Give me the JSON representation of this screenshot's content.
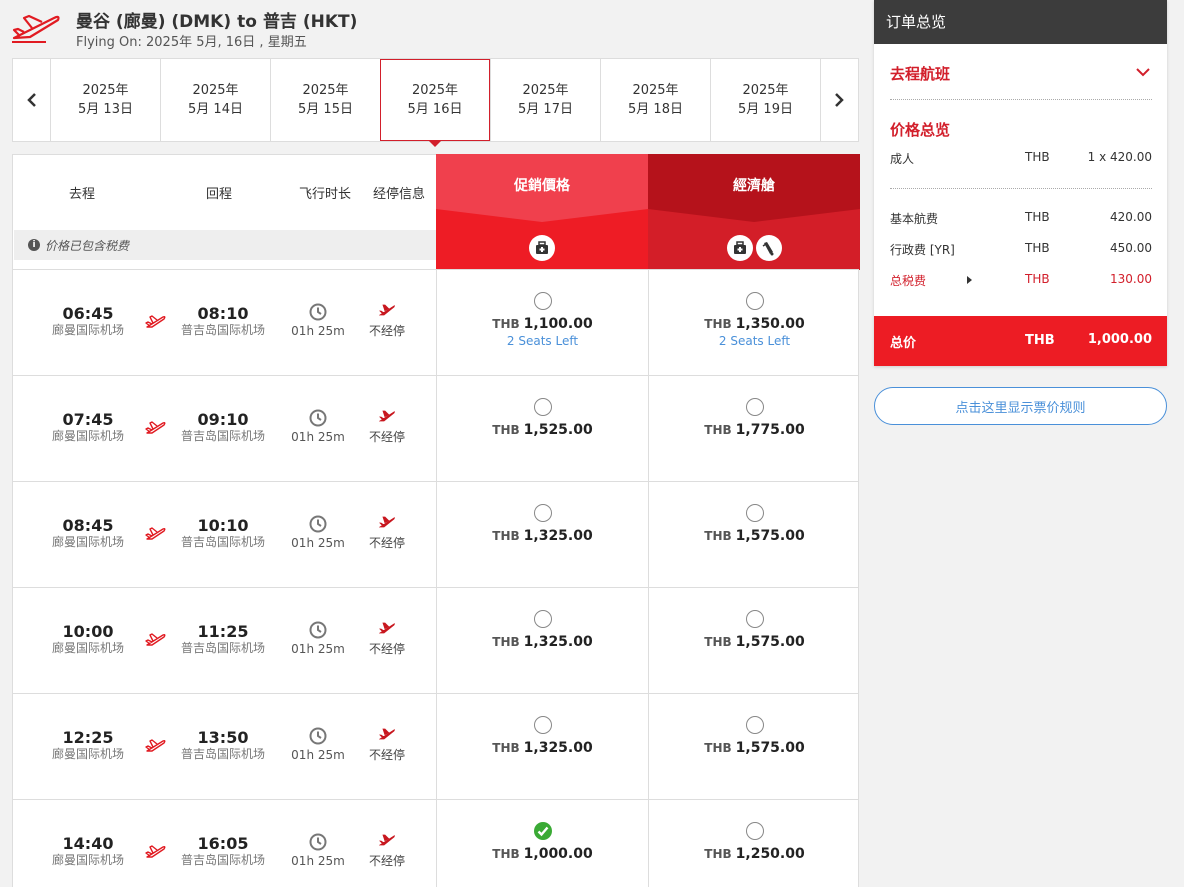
{
  "header": {
    "origin": "曼谷 (廊曼) (DMK)",
    "to_word": "to",
    "destination": "普吉 (HKT)",
    "flying_on": "Flying On: 2025年 5月, 16日 , 星期五"
  },
  "dates": [
    {
      "year": "2025年",
      "day": "5月 13日",
      "selected": false
    },
    {
      "year": "2025年",
      "day": "5月 14日",
      "selected": false
    },
    {
      "year": "2025年",
      "day": "5月 15日",
      "selected": false
    },
    {
      "year": "2025年",
      "day": "5月 16日",
      "selected": true
    },
    {
      "year": "2025年",
      "day": "5月 17日",
      "selected": false
    },
    {
      "year": "2025年",
      "day": "5月 18日",
      "selected": false
    },
    {
      "year": "2025年",
      "day": "5月 19日",
      "selected": false
    }
  ],
  "columns": {
    "depart": "去程",
    "arrive": "回程",
    "duration": "飞行时长",
    "stops": "经停信息",
    "tax_note": "价格已包含税费",
    "fare_promo": "促銷價格",
    "fare_economy": "經濟艙"
  },
  "colors": {
    "promo_top": "#f0404d",
    "promo_bottom": "#ee1c25",
    "economy_top": "#b5121b",
    "economy_bottom": "#d31e28",
    "accent": "#d21f2b",
    "link": "#4a90d9",
    "selected_radio": "#3aaa35"
  },
  "flights": [
    {
      "dep": "06:45",
      "dep_ap": "廊曼国际机场",
      "arr": "08:10",
      "arr_ap": "普吉岛国际机场",
      "duration": "01h 25m",
      "stops": "不经停",
      "promo": {
        "cur": "THB",
        "price": "1,100.00",
        "seats": "2 Seats Left",
        "selected": false
      },
      "economy": {
        "cur": "THB",
        "price": "1,350.00",
        "seats": "2 Seats Left",
        "selected": false
      }
    },
    {
      "dep": "07:45",
      "dep_ap": "廊曼国际机场",
      "arr": "09:10",
      "arr_ap": "普吉岛国际机场",
      "duration": "01h 25m",
      "stops": "不经停",
      "promo": {
        "cur": "THB",
        "price": "1,525.00",
        "seats": "",
        "selected": false
      },
      "economy": {
        "cur": "THB",
        "price": "1,775.00",
        "seats": "",
        "selected": false
      }
    },
    {
      "dep": "08:45",
      "dep_ap": "廊曼国际机场",
      "arr": "10:10",
      "arr_ap": "普吉岛国际机场",
      "duration": "01h 25m",
      "stops": "不经停",
      "promo": {
        "cur": "THB",
        "price": "1,325.00",
        "seats": "",
        "selected": false
      },
      "economy": {
        "cur": "THB",
        "price": "1,575.00",
        "seats": "",
        "selected": false
      }
    },
    {
      "dep": "10:00",
      "dep_ap": "廊曼国际机场",
      "arr": "11:25",
      "arr_ap": "普吉岛国际机场",
      "duration": "01h 25m",
      "stops": "不经停",
      "promo": {
        "cur": "THB",
        "price": "1,325.00",
        "seats": "",
        "selected": false
      },
      "economy": {
        "cur": "THB",
        "price": "1,575.00",
        "seats": "",
        "selected": false
      }
    },
    {
      "dep": "12:25",
      "dep_ap": "廊曼国际机场",
      "arr": "13:50",
      "arr_ap": "普吉岛国际机场",
      "duration": "01h 25m",
      "stops": "不经停",
      "promo": {
        "cur": "THB",
        "price": "1,325.00",
        "seats": "",
        "selected": false
      },
      "economy": {
        "cur": "THB",
        "price": "1,575.00",
        "seats": "",
        "selected": false
      }
    },
    {
      "dep": "14:40",
      "dep_ap": "廊曼国际机场",
      "arr": "16:05",
      "arr_ap": "普吉岛国际机场",
      "duration": "01h 25m",
      "stops": "不经停",
      "promo": {
        "cur": "THB",
        "price": "1,000.00",
        "seats": "",
        "selected": true
      },
      "economy": {
        "cur": "THB",
        "price": "1,250.00",
        "seats": "",
        "selected": false
      }
    }
  ],
  "summary": {
    "title": "订单总览",
    "outbound": "去程航班",
    "price_title": "价格总览",
    "adult_label": "成人",
    "adult_cur": "THB",
    "adult_value": "1 x 420.00",
    "base_label": "基本航费",
    "base_cur": "THB",
    "base_value": "420.00",
    "admin_label": "行政费 [YR]",
    "admin_cur": "THB",
    "admin_value": "450.00",
    "tax_label": "总税费",
    "tax_cur": "THB",
    "tax_value": "130.00",
    "total_label": "总价",
    "total_cur": "THB",
    "total_value": "1,000.00",
    "rules_button": "点击这里显示票价规则"
  }
}
